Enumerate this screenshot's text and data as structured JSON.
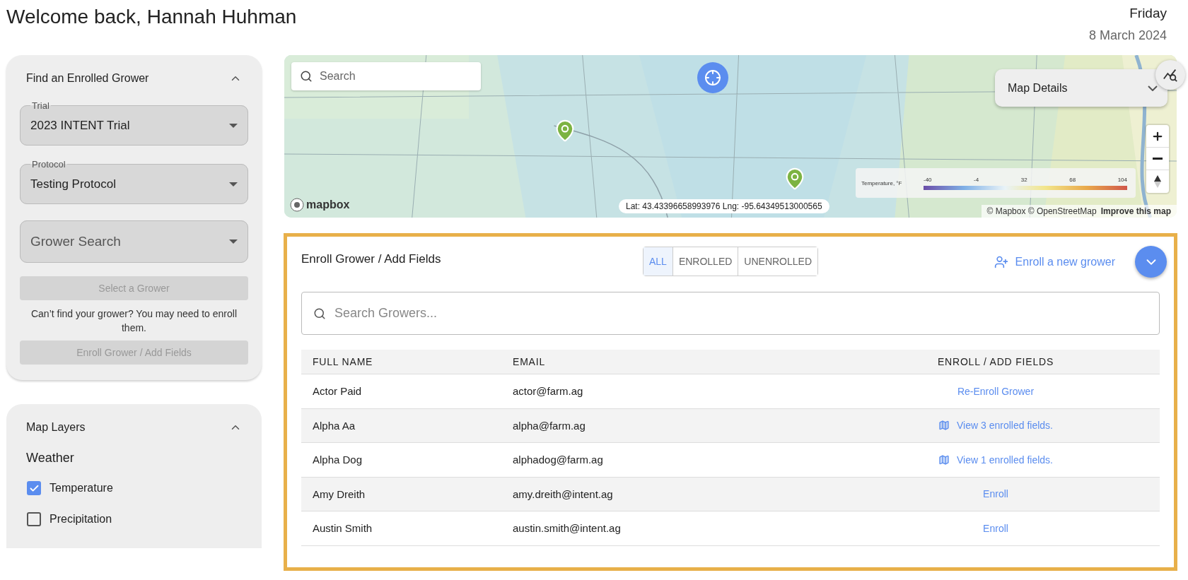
{
  "header": {
    "greeting": "Welcome back, Hannah Huhman",
    "weekday": "Friday",
    "date": "8 March 2024"
  },
  "find_grower": {
    "title": "Find an Enrolled Grower",
    "expanded": true,
    "selects": [
      {
        "label": "Trial",
        "value": "2023 INTENT Trial"
      },
      {
        "label": "Protocol",
        "value": "Testing Protocol"
      },
      {
        "placeholder": "Grower Search"
      }
    ],
    "select_button": {
      "label": "Select a Grower",
      "disabled": true
    },
    "hint": "Can’t find your grower? You may need to enroll them.",
    "enroll_button": {
      "label": "Enroll Grower / Add Fields",
      "disabled": true
    }
  },
  "map_layers": {
    "title": "Map Layers",
    "expanded": true,
    "group": "Weather",
    "layers": [
      {
        "label": "Temperature",
        "checked": true
      },
      {
        "label": "Precipitation",
        "checked": false
      }
    ]
  },
  "map": {
    "search": {
      "placeholder": "Search"
    },
    "details": "Map Details",
    "legend": {
      "title": "Temperature, °F",
      "ticks": [
        "-40",
        "-4",
        "32",
        "68",
        "104"
      ]
    },
    "coordinates": "Lat: 43.43396658993976 Lng: -95.64349513000565",
    "logo": "mapbox",
    "attribution": "© Mapbox © OpenStreetMap",
    "improve_link": "Improve this map"
  },
  "enroll": {
    "title": "Enroll Grower / Add Fields",
    "filters": [
      {
        "label": "ALL",
        "selected": true
      },
      {
        "label": "ENROLLED",
        "selected": false
      },
      {
        "label": "UNENROLLED",
        "selected": false
      }
    ],
    "new_grower": "Enroll a new grower",
    "search": {
      "placeholder": "Search Growers..."
    },
    "columns": [
      "FULL NAME",
      "EMAIL",
      "ENROLL / ADD FIELDS"
    ],
    "rows": [
      {
        "name": "Actor Paid",
        "email": "actor@farm.ag",
        "action": {
          "kind": "reenroll",
          "label": "Re-Enroll Grower"
        }
      },
      {
        "name": "Alpha Aa",
        "email": "alpha@farm.ag",
        "action": {
          "kind": "view",
          "label": "View 3 enrolled fields."
        }
      },
      {
        "name": "Alpha Dog",
        "email": "alphadog@farm.ag",
        "action": {
          "kind": "view",
          "label": "View 1 enrolled fields."
        }
      },
      {
        "name": "Amy Dreith",
        "email": "amy.dreith@intent.ag",
        "action": {
          "kind": "enroll",
          "label": "Enroll"
        }
      },
      {
        "name": "Austin Smith",
        "email": "austin.smith@intent.ag",
        "action": {
          "kind": "enroll",
          "label": "Enroll"
        }
      }
    ]
  }
}
